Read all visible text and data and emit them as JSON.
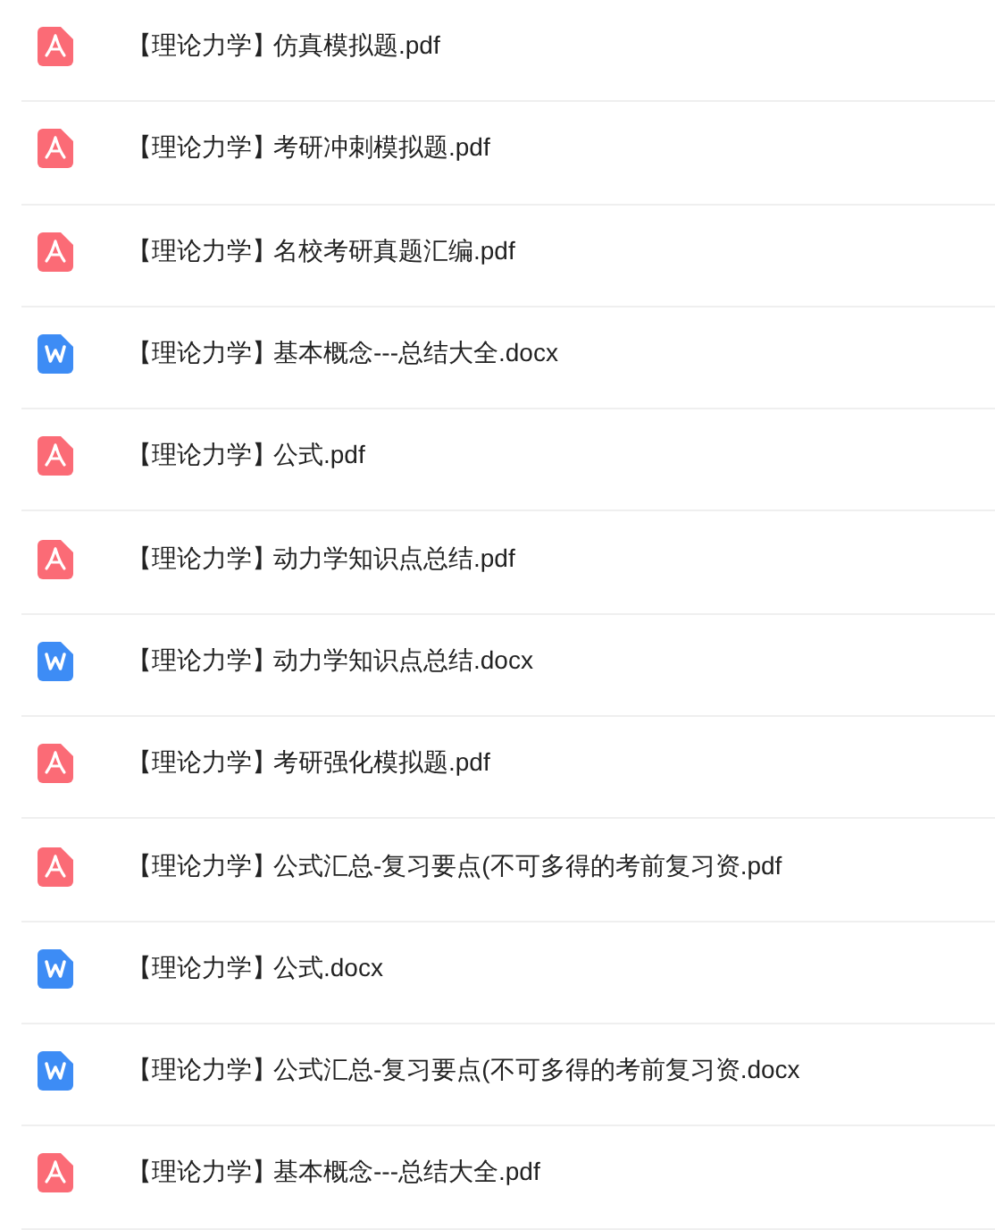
{
  "files": [
    {
      "kind": "pdf",
      "tag": "【理论力学】",
      "name": "仿真模拟题.pdf"
    },
    {
      "kind": "pdf",
      "tag": "【理论力学】",
      "name": "考研冲刺模拟题.pdf"
    },
    {
      "kind": "pdf",
      "tag": "【理论力学】",
      "name": "名校考研真题汇编.pdf"
    },
    {
      "kind": "docx",
      "tag": "【理论力学】",
      "name": "基本概念---总结大全.docx"
    },
    {
      "kind": "pdf",
      "tag": "【理论力学】",
      "name": "公式.pdf"
    },
    {
      "kind": "pdf",
      "tag": "【理论力学】",
      "name": "动力学知识点总结.pdf"
    },
    {
      "kind": "docx",
      "tag": "【理论力学】",
      "name": "动力学知识点总结.docx"
    },
    {
      "kind": "pdf",
      "tag": "【理论力学】",
      "name": "考研强化模拟题.pdf"
    },
    {
      "kind": "pdf",
      "tag": "【理论力学】",
      "name": "公式汇总-复习要点(不可多得的考前复习资.pdf"
    },
    {
      "kind": "docx",
      "tag": "【理论力学】",
      "name": "公式.docx"
    },
    {
      "kind": "docx",
      "tag": "【理论力学】",
      "name": "公式汇总-复习要点(不可多得的考前复习资.docx"
    },
    {
      "kind": "pdf",
      "tag": "【理论力学】",
      "name": "基本概念---总结大全.pdf"
    }
  ]
}
